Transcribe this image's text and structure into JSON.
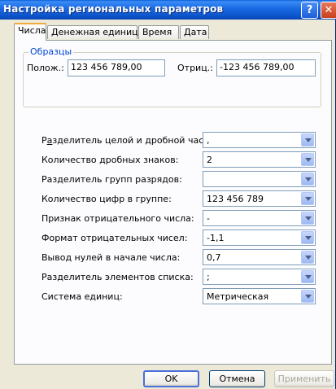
{
  "window": {
    "title": "Настройка региональных параметров",
    "help_label": "?",
    "close_label": "✕"
  },
  "tabs": [
    {
      "label": "Числа",
      "active": true
    },
    {
      "label": "Денежная единица",
      "active": false
    },
    {
      "label": "Время",
      "active": false
    },
    {
      "label": "Дата",
      "active": false
    }
  ],
  "samples": {
    "legend": "Образцы",
    "positive_label": "Полож.:",
    "positive_value": "123 456 789,00",
    "negative_label": "Отриц.:",
    "negative_value": "-123 456 789,00"
  },
  "settings": [
    {
      "label": "Разделитель целой и дробной части:",
      "value": ","
    },
    {
      "label": "Количество дробных знаков:",
      "value": "2"
    },
    {
      "label": "Разделитель групп разрядов:",
      "value": ""
    },
    {
      "label": "Количество цифр в группе:",
      "value": "123 456 789"
    },
    {
      "label": "Признак отрицательного числа:",
      "value": "-"
    },
    {
      "label": "Формат отрицательных чисел:",
      "value": "-1,1"
    },
    {
      "label": "Вывод нулей в начале числа:",
      "value": "0,7"
    },
    {
      "label": "Разделитель элементов списка:",
      "value": ";"
    },
    {
      "label": "Система единиц:",
      "value": "Метрическая"
    }
  ],
  "buttons": {
    "ok": "OK",
    "cancel": "Отмена",
    "apply": "Применить"
  }
}
